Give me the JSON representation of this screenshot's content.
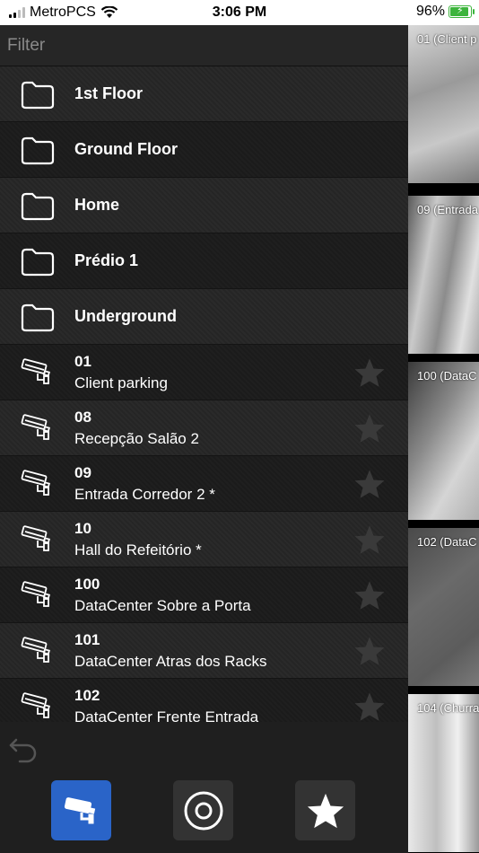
{
  "status_bar": {
    "carrier": "MetroPCS",
    "time": "3:06 PM",
    "battery_percent": "96%",
    "battery_level": 0.96,
    "signal_bars": 2,
    "wifi_icon": "wifi-icon"
  },
  "filter": {
    "placeholder": "Filter"
  },
  "folders": [
    {
      "label": "1st Floor",
      "icon": "folder-icon"
    },
    {
      "label": "Ground Floor",
      "icon": "folder-icon"
    },
    {
      "label": "Home",
      "icon": "folder-icon"
    },
    {
      "label": "Prédio 1",
      "icon": "folder-icon"
    },
    {
      "label": "Underground",
      "icon": "folder-icon"
    }
  ],
  "cameras": [
    {
      "number": "01",
      "name": "Client parking",
      "favorite": false
    },
    {
      "number": "08",
      "name": "Recepção Salão 2",
      "favorite": false
    },
    {
      "number": "09",
      "name": "Entrada Corredor 2 *",
      "favorite": false
    },
    {
      "number": "10",
      "name": "Hall do Refeitório *",
      "favorite": false
    },
    {
      "number": "100",
      "name": "DataCenter Sobre a Porta",
      "favorite": false
    },
    {
      "number": "101",
      "name": "DataCenter Atras dos Racks",
      "favorite": false
    },
    {
      "number": "102",
      "name": "DataCenter Frente Entrada",
      "favorite": false
    }
  ],
  "toolbar": {
    "undo_icon": "undo-icon",
    "buttons": [
      {
        "icon": "camera-icon",
        "active": true
      },
      {
        "icon": "record-icon",
        "active": false
      },
      {
        "icon": "star-icon",
        "active": false
      }
    ],
    "active_color": "#2a64c8"
  },
  "thumbnails": [
    {
      "label": "01 (Client p"
    },
    {
      "label": "09 (Entrada"
    },
    {
      "label": "100 (DataC"
    },
    {
      "label": "102 (DataC"
    },
    {
      "label": "104 (Churra"
    }
  ]
}
